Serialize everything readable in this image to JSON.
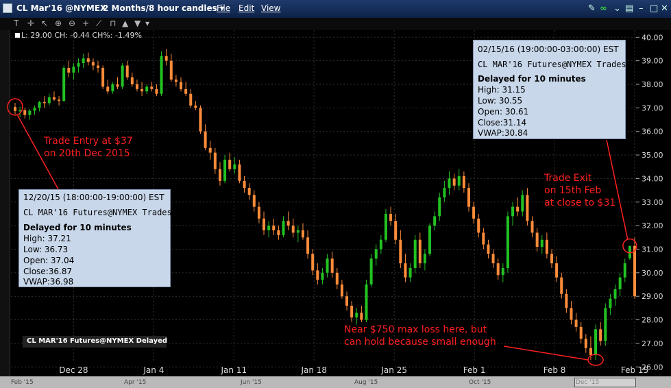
{
  "window": {
    "symbol_title": "CL Mar'16 @NYMEX",
    "timeframe": "2 Months/8 hour candles ▾",
    "menu": [
      "File",
      "Edit",
      "View"
    ]
  },
  "legend_readout": "L: 29.00 CH: -0.44 CH%: -1.49%",
  "instrument_tag": "CL MAR'16 Futures@NYMEX Delayed",
  "tooltip_entry": {
    "date": "12/20/15 (18:00:00-19:00:00) EST",
    "name": "CL MAR'16 Futures@NYMEX Trades",
    "delay": "Delayed for 10 minutes",
    "high": "High:  37.21",
    "low": "Low:    36.73",
    "open": "Open: 37.04",
    "close": "Close:36.87",
    "vwap": "VWAP:36.98"
  },
  "tooltip_exit": {
    "date": "02/15/16 (19:00:00-03:00:00) EST",
    "name": "CL MAR'16 Futures@NYMEX Trades",
    "delay": "Delayed for 10 minutes",
    "high": "High:  31.15",
    "low": "Low:    30.55",
    "open": "Open: 30.61",
    "close": "Close:31.14",
    "vwap": "VWAP:30.84"
  },
  "nav_labels": [
    "Feb '15",
    "Apr '15",
    "Jun '15",
    "Aug '15",
    "Oct '15",
    "Dec '15"
  ],
  "colors": {
    "up": "#22c222",
    "down": "#ff8c3a",
    "annotation": "#ff2020",
    "background": "#000000",
    "tooltip": "#c8d7ea"
  },
  "chart_data": {
    "type": "candlestick",
    "x_tick_labels": [
      "Dec 28",
      "Jan 4",
      "Jan 11",
      "Jan 18",
      "Jan 25",
      "Feb 1",
      "Feb 8",
      "Feb 15"
    ],
    "y_ticks": [
      26.0,
      27.0,
      28.0,
      29.0,
      30.0,
      31.0,
      32.0,
      33.0,
      34.0,
      35.0,
      36.0,
      37.0,
      38.0,
      39.0,
      40.0
    ],
    "ylim": [
      25.6,
      40.3
    ],
    "candles": [
      [
        37.04,
        37.21,
        36.73,
        36.87
      ],
      [
        36.87,
        37.05,
        36.6,
        36.9
      ],
      [
        36.9,
        37.0,
        36.55,
        36.7
      ],
      [
        36.7,
        36.95,
        36.5,
        36.88
      ],
      [
        36.88,
        37.1,
        36.7,
        37.0
      ],
      [
        37.0,
        37.3,
        36.85,
        37.25
      ],
      [
        37.25,
        37.5,
        37.0,
        37.2
      ],
      [
        37.2,
        37.6,
        37.1,
        37.45
      ],
      [
        37.45,
        37.7,
        37.3,
        37.35
      ],
      [
        37.35,
        37.5,
        37.1,
        37.3
      ],
      [
        37.3,
        38.8,
        37.25,
        38.7
      ],
      [
        38.7,
        39.0,
        38.3,
        38.5
      ],
      [
        38.5,
        38.9,
        38.2,
        38.75
      ],
      [
        38.75,
        39.1,
        38.5,
        38.9
      ],
      [
        38.9,
        39.3,
        38.7,
        39.1
      ],
      [
        39.1,
        39.35,
        38.8,
        38.95
      ],
      [
        38.95,
        39.1,
        38.6,
        38.8
      ],
      [
        38.8,
        39.0,
        38.5,
        38.7
      ],
      [
        38.7,
        38.8,
        37.8,
        37.9
      ],
      [
        37.9,
        38.2,
        37.6,
        37.7
      ],
      [
        37.7,
        38.1,
        37.6,
        38.0
      ],
      [
        38.0,
        38.3,
        37.8,
        37.9
      ],
      [
        37.9,
        38.9,
        37.8,
        38.8
      ],
      [
        38.8,
        39.0,
        38.2,
        38.3
      ],
      [
        38.3,
        38.5,
        37.9,
        38.0
      ],
      [
        38.0,
        38.2,
        37.7,
        37.8
      ],
      [
        37.8,
        38.1,
        37.5,
        37.7
      ],
      [
        37.7,
        38.0,
        37.6,
        37.9
      ],
      [
        37.9,
        38.1,
        37.7,
        37.8
      ],
      [
        37.8,
        38.0,
        37.5,
        37.6
      ],
      [
        37.6,
        39.4,
        37.5,
        39.2
      ],
      [
        39.2,
        39.5,
        38.8,
        39.0
      ],
      [
        39.0,
        39.3,
        38.1,
        38.2
      ],
      [
        38.2,
        38.4,
        37.9,
        38.1
      ],
      [
        38.1,
        38.3,
        37.7,
        37.8
      ],
      [
        37.8,
        38.1,
        37.5,
        37.6
      ],
      [
        37.6,
        37.8,
        37.0,
        37.1
      ],
      [
        37.1,
        37.3,
        36.9,
        37.0
      ],
      [
        37.0,
        37.1,
        35.9,
        36.0
      ],
      [
        36.0,
        36.3,
        35.2,
        35.3
      ],
      [
        35.3,
        35.6,
        34.8,
        35.1
      ],
      [
        35.1,
        35.3,
        34.2,
        34.4
      ],
      [
        34.4,
        34.7,
        33.7,
        33.9
      ],
      [
        33.9,
        35.0,
        33.8,
        34.8
      ],
      [
        34.8,
        35.1,
        34.3,
        34.4
      ],
      [
        34.4,
        34.9,
        34.2,
        34.6
      ],
      [
        34.6,
        34.8,
        33.8,
        33.9
      ],
      [
        33.9,
        34.1,
        33.4,
        33.6
      ],
      [
        33.6,
        33.8,
        33.1,
        33.3
      ],
      [
        33.3,
        33.5,
        32.6,
        32.8
      ],
      [
        32.8,
        33.0,
        32.1,
        32.3
      ],
      [
        32.3,
        32.6,
        31.6,
        31.8
      ],
      [
        31.8,
        32.2,
        31.5,
        32.0
      ],
      [
        32.0,
        32.3,
        31.6,
        31.8
      ],
      [
        31.8,
        32.0,
        31.4,
        31.6
      ],
      [
        31.6,
        32.4,
        31.5,
        32.2
      ],
      [
        32.2,
        32.6,
        31.8,
        32.0
      ],
      [
        32.0,
        32.3,
        31.5,
        31.7
      ],
      [
        31.7,
        32.0,
        31.3,
        31.8
      ],
      [
        31.8,
        32.1,
        31.4,
        31.5
      ],
      [
        31.5,
        31.8,
        30.6,
        30.8
      ],
      [
        30.8,
        31.0,
        29.9,
        30.1
      ],
      [
        30.1,
        30.4,
        29.5,
        29.7
      ],
      [
        29.7,
        30.2,
        29.5,
        30.0
      ],
      [
        30.0,
        30.8,
        29.8,
        30.6
      ],
      [
        30.6,
        30.9,
        29.8,
        30.0
      ],
      [
        30.0,
        30.2,
        29.3,
        29.5
      ],
      [
        29.5,
        29.7,
        28.9,
        29.0
      ],
      [
        29.0,
        29.2,
        28.4,
        28.6
      ],
      [
        28.6,
        28.8,
        27.9,
        28.1
      ],
      [
        28.1,
        28.5,
        27.8,
        28.3
      ],
      [
        28.3,
        28.6,
        27.9,
        28.0
      ],
      [
        28.0,
        29.7,
        27.9,
        29.5
      ],
      [
        29.5,
        30.8,
        29.4,
        30.6
      ],
      [
        30.6,
        31.2,
        30.3,
        31.0
      ],
      [
        31.0,
        31.6,
        30.8,
        31.4
      ],
      [
        31.4,
        32.7,
        31.3,
        32.5
      ],
      [
        32.5,
        32.8,
        32.0,
        32.2
      ],
      [
        32.2,
        32.5,
        31.2,
        31.4
      ],
      [
        31.4,
        31.8,
        30.2,
        30.4
      ],
      [
        30.4,
        30.8,
        29.6,
        29.8
      ],
      [
        29.8,
        30.4,
        29.6,
        30.2
      ],
      [
        30.2,
        31.6,
        30.0,
        31.4
      ],
      [
        31.4,
        31.7,
        30.2,
        30.4
      ],
      [
        30.4,
        31.0,
        30.1,
        30.8
      ],
      [
        30.8,
        32.1,
        30.7,
        32.0
      ],
      [
        32.0,
        32.6,
        31.8,
        32.4
      ],
      [
        32.4,
        33.4,
        32.2,
        33.2
      ],
      [
        33.2,
        33.9,
        33.0,
        33.6
      ],
      [
        33.6,
        34.3,
        33.3,
        34.0
      ],
      [
        34.0,
        34.2,
        33.5,
        33.7
      ],
      [
        33.7,
        34.4,
        33.5,
        34.1
      ],
      [
        34.1,
        34.3,
        33.4,
        33.6
      ],
      [
        33.6,
        33.8,
        32.6,
        32.8
      ],
      [
        32.8,
        33.0,
        32.1,
        32.3
      ],
      [
        32.3,
        32.5,
        31.5,
        31.7
      ],
      [
        31.7,
        31.9,
        31.0,
        31.2
      ],
      [
        31.2,
        31.4,
        30.6,
        30.8
      ],
      [
        30.8,
        31.0,
        30.2,
        30.4
      ],
      [
        30.4,
        30.6,
        29.7,
        29.9
      ],
      [
        29.9,
        30.4,
        29.6,
        30.2
      ],
      [
        30.2,
        32.6,
        30.0,
        32.4
      ],
      [
        32.4,
        33.0,
        32.0,
        32.8
      ],
      [
        32.8,
        33.2,
        32.4,
        32.6
      ],
      [
        32.6,
        33.5,
        32.4,
        33.3
      ],
      [
        33.3,
        33.6,
        32.0,
        32.2
      ],
      [
        32.2,
        32.4,
        31.5,
        31.7
      ],
      [
        31.7,
        31.9,
        30.9,
        31.1
      ],
      [
        31.1,
        31.6,
        30.8,
        31.4
      ],
      [
        31.4,
        31.7,
        30.6,
        30.8
      ],
      [
        30.8,
        31.0,
        30.2,
        30.4
      ],
      [
        30.4,
        30.7,
        29.6,
        29.8
      ],
      [
        29.8,
        30.0,
        28.9,
        29.1
      ],
      [
        29.1,
        29.3,
        28.3,
        28.5
      ],
      [
        28.5,
        28.8,
        27.8,
        28.0
      ],
      [
        28.0,
        28.3,
        27.5,
        27.7
      ],
      [
        27.7,
        27.9,
        27.0,
        27.2
      ],
      [
        27.2,
        27.4,
        26.6,
        26.8
      ],
      [
        26.8,
        27.3,
        26.3,
        26.5
      ],
      [
        26.5,
        27.8,
        26.3,
        27.6
      ],
      [
        27.6,
        27.9,
        26.9,
        27.1
      ],
      [
        27.1,
        28.7,
        26.9,
        28.5
      ],
      [
        28.5,
        29.1,
        28.2,
        28.9
      ],
      [
        28.9,
        29.5,
        28.6,
        29.3
      ],
      [
        29.3,
        30.0,
        29.0,
        29.8
      ],
      [
        29.8,
        30.6,
        29.6,
        30.4
      ],
      [
        30.61,
        31.15,
        30.55,
        31.14
      ],
      [
        31.14,
        31.5,
        28.9,
        29.0
      ]
    ]
  },
  "annotations": {
    "entry_text": [
      "Trade Entry at $37",
      "on 20th Dec 2015"
    ],
    "exit_text": [
      "Trade Exit",
      "on 15th Feb",
      "at close to $31"
    ],
    "low_text": [
      "Near $750 max loss here, but",
      "can hold because small enough"
    ]
  }
}
